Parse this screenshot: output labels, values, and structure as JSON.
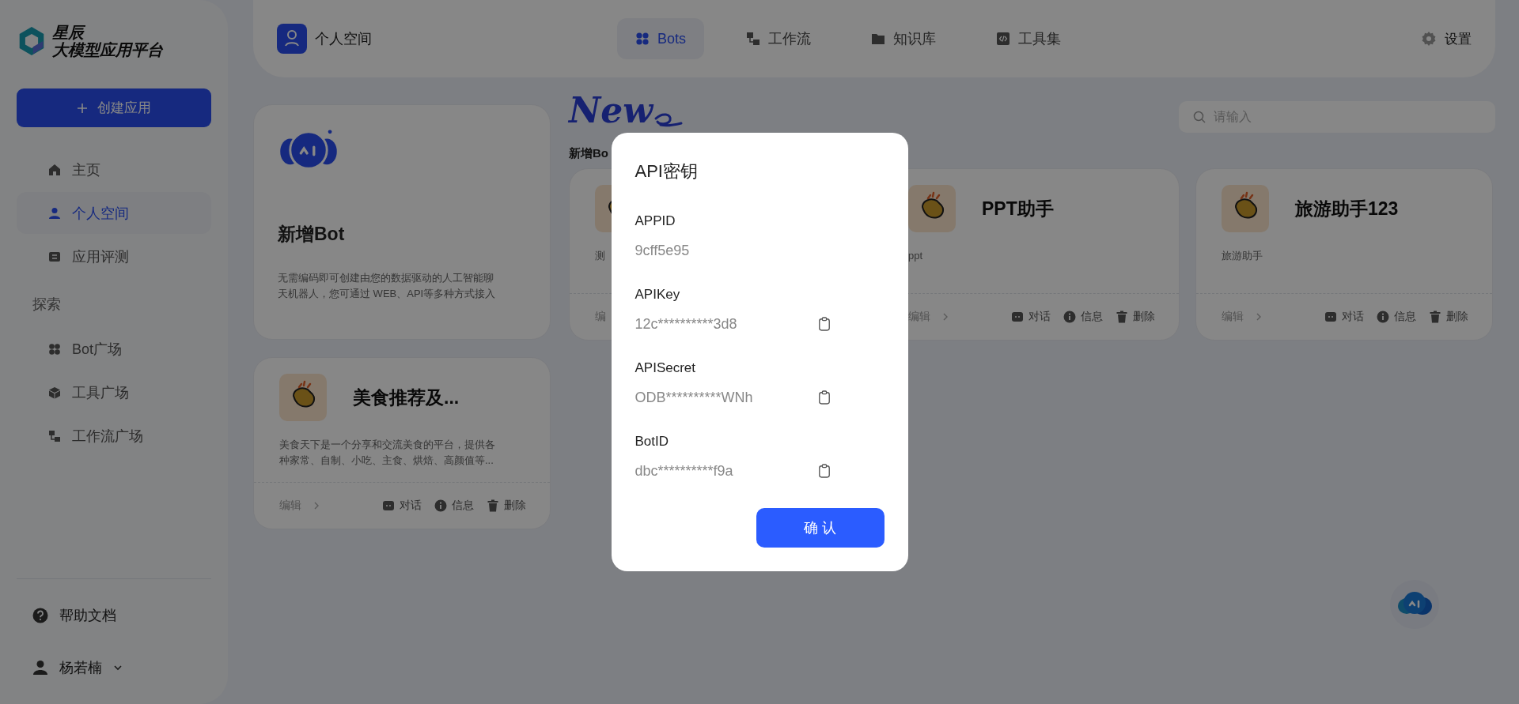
{
  "sidebar": {
    "logo_lines": [
      "星辰",
      "大模型应用平台"
    ],
    "create_button": "创建应用",
    "nav_items": [
      {
        "label": "主页",
        "selected": false
      },
      {
        "label": "个人空间",
        "selected": true
      },
      {
        "label": "应用评测",
        "selected": false
      }
    ],
    "explore_heading": "探索",
    "explore_items": [
      {
        "label": "Bot广场",
        "selected": false
      },
      {
        "label": "工具广场",
        "selected": false
      },
      {
        "label": "工作流广场",
        "selected": false
      }
    ],
    "help": "帮助文档",
    "user": "杨若楠"
  },
  "top_bar": {
    "space": "个人空间",
    "tabs": [
      {
        "label": "Bots",
        "selected": true
      },
      {
        "label": "工作流",
        "selected": false
      },
      {
        "label": "知识库",
        "selected": false
      },
      {
        "label": "工具集",
        "selected": false
      }
    ],
    "settings": "设置"
  },
  "new_bot_card": {
    "title": "新增Bot",
    "description": "无需编码即可创建由您的数据驱动的人工智能聊天机器人，您可通过 WEB、API等多种方式接入"
  },
  "banner_text": "New",
  "section_label": "新增Bo",
  "search": {
    "placeholder": "请输入"
  },
  "bots": [
    {
      "description": "测",
      "edit": "编"
    },
    {
      "name": "PPT助手",
      "description": "ppt",
      "edit": "编辑",
      "actions": [
        "对话",
        "信息",
        "删除"
      ]
    },
    {
      "name": "旅游助手123",
      "description": "旅游助手",
      "edit": "编辑",
      "actions": [
        "对话",
        "信息",
        "删除"
      ]
    },
    {
      "name": "美食推荐及...",
      "description": "美食天下是一个分享和交流美食的平台，提供各种家常、自制、小吃、主食、烘焙、高颜值等...",
      "edit": "编辑",
      "actions": [
        "对话",
        "信息",
        "删除"
      ]
    }
  ],
  "dialog": {
    "title": "API密钥",
    "fields": [
      {
        "label": "APPID",
        "value": "9cff5e95",
        "copyable": false
      },
      {
        "label": "APIKey",
        "value": "12c**********3d8",
        "copyable": true
      },
      {
        "label": "APISecret",
        "value": "ODB**********WNh",
        "copyable": true
      },
      {
        "label": "BotID",
        "value": "dbc**********f9a",
        "copyable": true
      }
    ],
    "confirm": "确 认"
  }
}
